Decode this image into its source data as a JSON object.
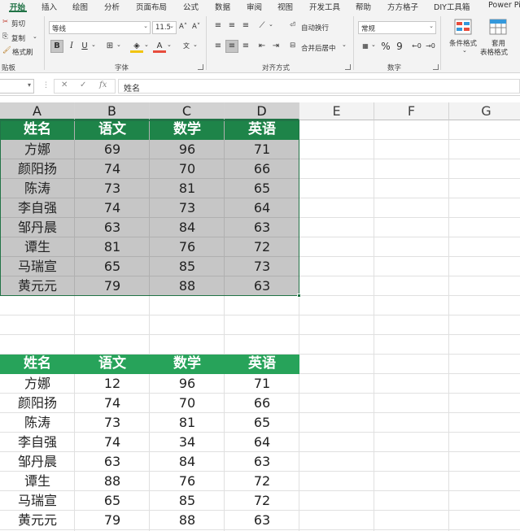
{
  "ribbon_tabs": [
    "开始",
    "插入",
    "绘图",
    "分析",
    "页面布局",
    "公式",
    "数据",
    "审阅",
    "视图",
    "开发工具",
    "帮助",
    "方方格子",
    "DIY工具箱",
    "Power Pi"
  ],
  "clipboard": {
    "cut": "剪切",
    "copy": "复制",
    "format_painter": "格式刷",
    "group_label": "贴板"
  },
  "font": {
    "name": "等线",
    "size": "11.5",
    "grow": "A˄",
    "shrink": "A˅",
    "bold": "B",
    "italic": "I",
    "underline": "U",
    "group_label": "字体"
  },
  "alignment": {
    "wrap_text": "自动换行",
    "merge_center": "合并后居中",
    "group_label": "对齐方式"
  },
  "number": {
    "format": "常规",
    "percent": "%",
    "comma": "9",
    "group_label": "数字"
  },
  "styles": {
    "conditional_format": "条件格式",
    "table_format_1": "套用",
    "table_format_2": "表格格式"
  },
  "formula_bar": {
    "fx_label": "fx",
    "cancel": "✕",
    "confirm": "✓",
    "content": "姓名"
  },
  "columns": [
    "A",
    "B",
    "C",
    "D",
    "E",
    "F",
    "G"
  ],
  "colors": {
    "accent": "#217346",
    "header_top": "#1e8449",
    "header_bottom": "#27a35a",
    "selection_fill": "#c6c6c6"
  },
  "table1": {
    "headers": [
      "姓名",
      "语文",
      "数学",
      "英语"
    ],
    "rows": [
      [
        "方娜",
        "69",
        "96",
        "71"
      ],
      [
        "颜阳扬",
        "74",
        "70",
        "66"
      ],
      [
        "陈涛",
        "73",
        "81",
        "65"
      ],
      [
        "李自强",
        "74",
        "73",
        "64"
      ],
      [
        "邹丹晨",
        "63",
        "84",
        "63"
      ],
      [
        "谭生",
        "81",
        "76",
        "72"
      ],
      [
        "马瑞宣",
        "65",
        "85",
        "73"
      ],
      [
        "黄元元",
        "79",
        "88",
        "63"
      ]
    ]
  },
  "table2": {
    "headers": [
      "姓名",
      "语文",
      "数学",
      "英语"
    ],
    "rows": [
      [
        "方娜",
        "12",
        "96",
        "71"
      ],
      [
        "颜阳扬",
        "74",
        "70",
        "66"
      ],
      [
        "陈涛",
        "73",
        "81",
        "65"
      ],
      [
        "李自强",
        "74",
        "34",
        "64"
      ],
      [
        "邹丹晨",
        "63",
        "84",
        "63"
      ],
      [
        "谭生",
        "88",
        "76",
        "72"
      ],
      [
        "马瑞宣",
        "65",
        "85",
        "72"
      ],
      [
        "黄元元",
        "79",
        "88",
        "63"
      ]
    ]
  }
}
